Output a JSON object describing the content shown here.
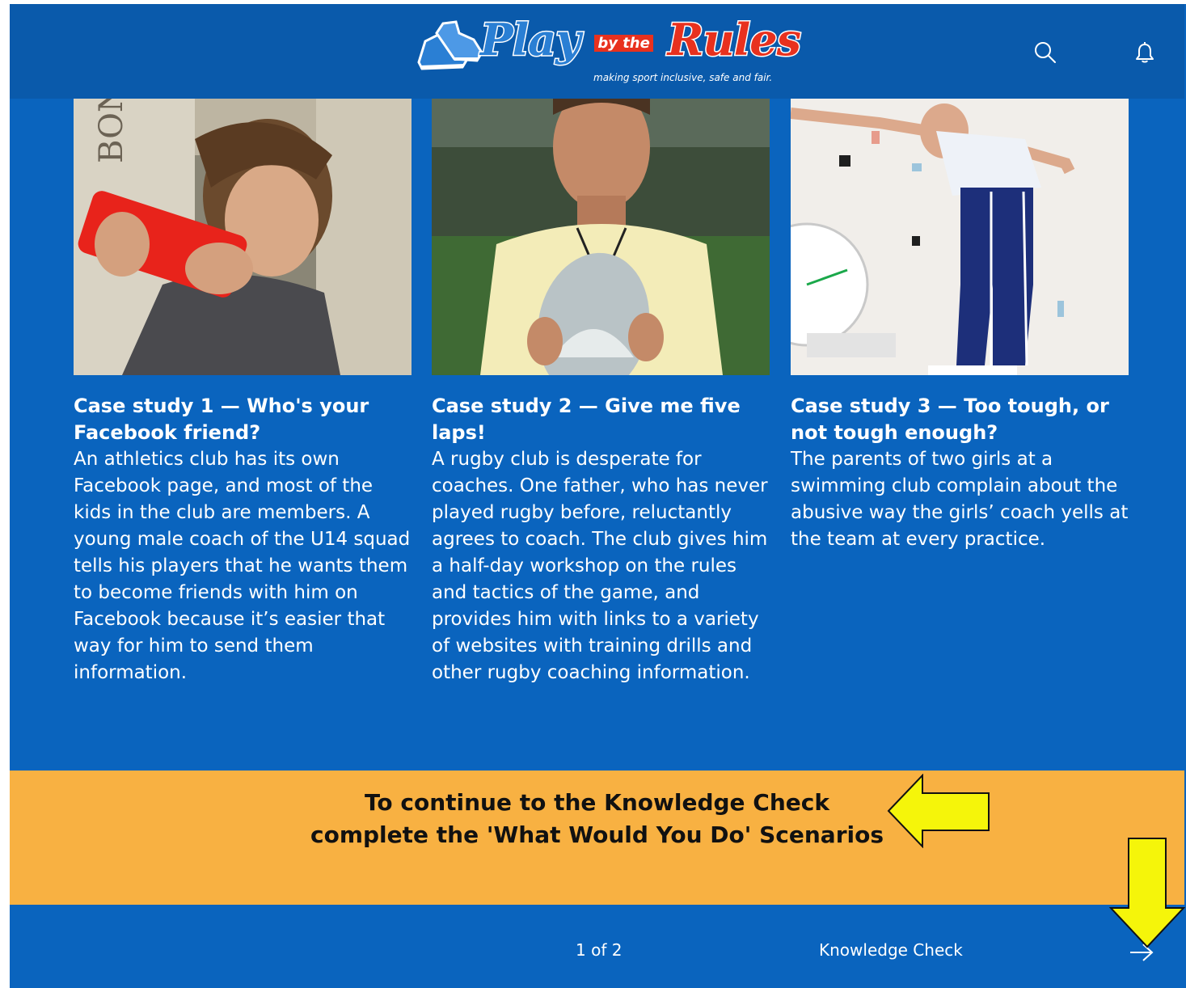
{
  "header": {
    "logo": {
      "play": "Play",
      "bythe": "by the",
      "rules": "Rules",
      "tagline": "making sport inclusive, safe and fair."
    },
    "icons": [
      "search-icon",
      "bell-icon"
    ]
  },
  "cards": [
    {
      "title": "Case study 1 — Who's your Facebook friend?",
      "body": "An athletics club has its own Facebook page, and most of the kids in the club are members. A young male coach of the U14 squad tells his players that he wants them to become friends with him on Facebook because it’s easier that way for him to send them information."
    },
    {
      "title": "Case study 2 — Give me five laps!",
      "body": "A rugby club is desperate for coaches. One father, who has never played rugby before, reluctantly agrees to coach. The club gives him a half-day workshop on the rules and tactics of the game, and provides him with links to a variety of websites with training drills and other rugby coaching information."
    },
    {
      "title": "Case study 3 — Too tough, or not tough enough?",
      "body": "The parents of two girls at a swimming club complain about the abusive way the girls’ coach yells at the team at every practice."
    }
  ],
  "banner": {
    "line1": "To continue to the Knowledge Check",
    "line2": "complete the 'What Would You Do' Scenarios"
  },
  "footer": {
    "pager": "1 of 2",
    "next_label": "Knowledge Check"
  },
  "colors": {
    "background": "#0a64be",
    "header": "#0a5aab",
    "banner": "#f8b142",
    "annotation_arrow": "#f5f50a"
  }
}
